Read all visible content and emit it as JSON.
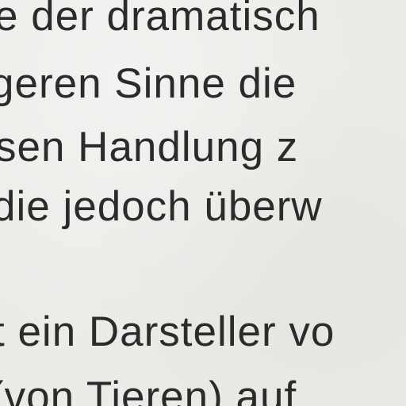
{
  "text": {
    "lines": [
      "e der dramatisch",
      "geren Sinne die",
      "sen Handlung z",
      "die jedoch überw",
      "t ein Darsteller vo",
      "(von Tieren) auf"
    ]
  }
}
